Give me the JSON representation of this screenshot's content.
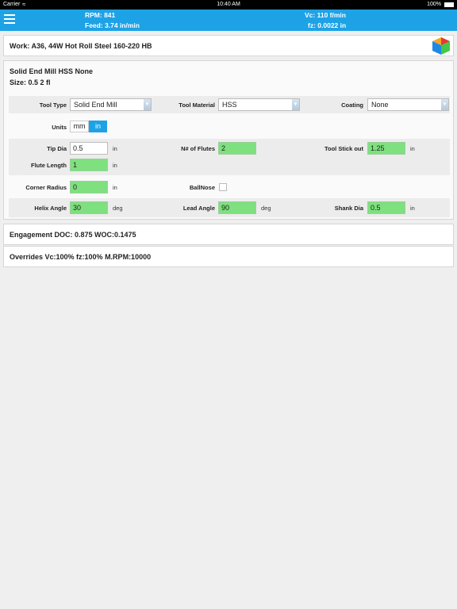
{
  "status_bar": {
    "carrier": "Carrier",
    "time": "10:40 AM",
    "battery": "100%"
  },
  "header": {
    "rpm": "RPM: 841",
    "feed": "Feed: 3.74 in/min",
    "vc": "Vc: 110 f/min",
    "fz": "fz: 0.0022 in"
  },
  "work": {
    "title": "Work: A36, 44W Hot Roll Steel 160-220 HB"
  },
  "tool": {
    "title": "Solid End Mill HSS None",
    "size": "Size: 0.5 2 fl",
    "tool_type_label": "Tool Type",
    "tool_type_value": "Solid End Mill",
    "tool_material_label": "Tool Material",
    "tool_material_value": "HSS",
    "coating_label": "Coating",
    "coating_value": "None",
    "units_label": "Units",
    "units_options": [
      "mm",
      "in"
    ],
    "units_selected": "in",
    "tip_dia_label": "Tip Dia",
    "tip_dia_value": "0.5",
    "tip_dia_unit": "in",
    "flutes_label": "N# of Flutes",
    "flutes_value": "2",
    "stick_out_label": "Tool Stick out",
    "stick_out_value": "1.25",
    "stick_out_unit": "in",
    "flute_length_label": "Flute Length",
    "flute_length_value": "1",
    "flute_length_unit": "in",
    "corner_radius_label": "Corner Radius",
    "corner_radius_value": "0",
    "corner_radius_unit": "in",
    "ballnose_label": "BallNose",
    "helix_label": "Helix Angle",
    "helix_value": "30",
    "helix_unit": "deg",
    "lead_label": "Lead Angle",
    "lead_value": "90",
    "lead_unit": "deg",
    "shank_label": "Shank Dia",
    "shank_value": "0.5",
    "shank_unit": "in"
  },
  "engagement": {
    "title": "Engagement DOC: 0.875 WOC:0.1475"
  },
  "overrides": {
    "title": "Overrides Vc:100% fz:100% M.RPM:10000"
  },
  "colors": {
    "accent": "#1ea2e6",
    "field_green": "#7ee07e"
  }
}
